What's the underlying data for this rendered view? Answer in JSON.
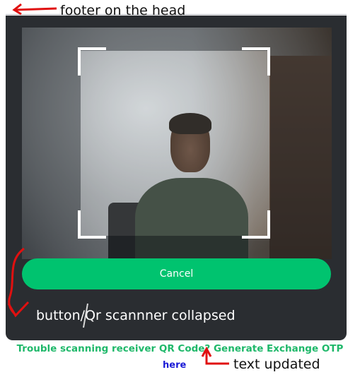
{
  "annotations": {
    "top": "footer on the head",
    "button": "button/Qr scannner collapsed",
    "text": "text updated"
  },
  "scanner": {
    "cancel_label": "Cancel"
  },
  "footer": {
    "trouble_text": "Trouble scanning receiver QR Code? Generate Exchange OTP",
    "here_label": "here"
  },
  "colors": {
    "panel": "#2a2d31",
    "accent": "#00c36f",
    "link": "#1a1ad6",
    "annotation": "#e01010"
  }
}
